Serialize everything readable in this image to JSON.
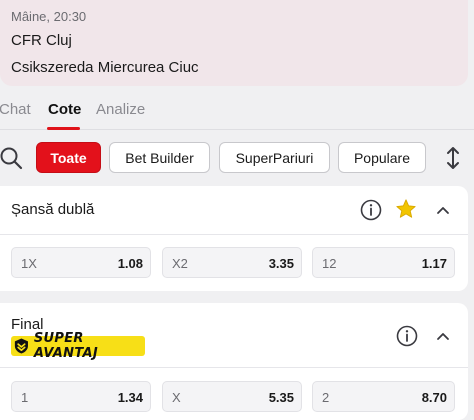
{
  "match": {
    "time": "Mâine, 20:30",
    "home": "CFR Cluj",
    "away": "Csikszereda Miercurea Ciuc"
  },
  "tabs": [
    {
      "label": "Chat",
      "active": false
    },
    {
      "label": "Cote",
      "active": true
    },
    {
      "label": "Analize",
      "active": false
    }
  ],
  "filters": [
    {
      "label": "Toate",
      "active": true
    },
    {
      "label": "Bet Builder",
      "active": false
    },
    {
      "label": "SuperPariuri",
      "active": false
    },
    {
      "label": "Populare",
      "active": false
    }
  ],
  "markets": [
    {
      "title": "Șansă dublă",
      "icons": [
        "info-icon",
        "star-icon",
        "chevron-up-icon"
      ],
      "odds": [
        {
          "label": "1X",
          "value": "1.08"
        },
        {
          "label": "X2",
          "value": "3.35"
        },
        {
          "label": "12",
          "value": "1.17"
        }
      ]
    },
    {
      "title": "Final",
      "badge": "SUPER AVANTAJ",
      "icons": [
        "info-icon",
        "chevron-up-icon"
      ],
      "odds": [
        {
          "label": "1",
          "value": "1.34"
        },
        {
          "label": "X",
          "value": "5.35"
        },
        {
          "label": "2",
          "value": "8.70"
        }
      ]
    }
  ],
  "colors": {
    "accent": "#e3111b",
    "star": "#f2c500",
    "badge": "#f7df17"
  }
}
